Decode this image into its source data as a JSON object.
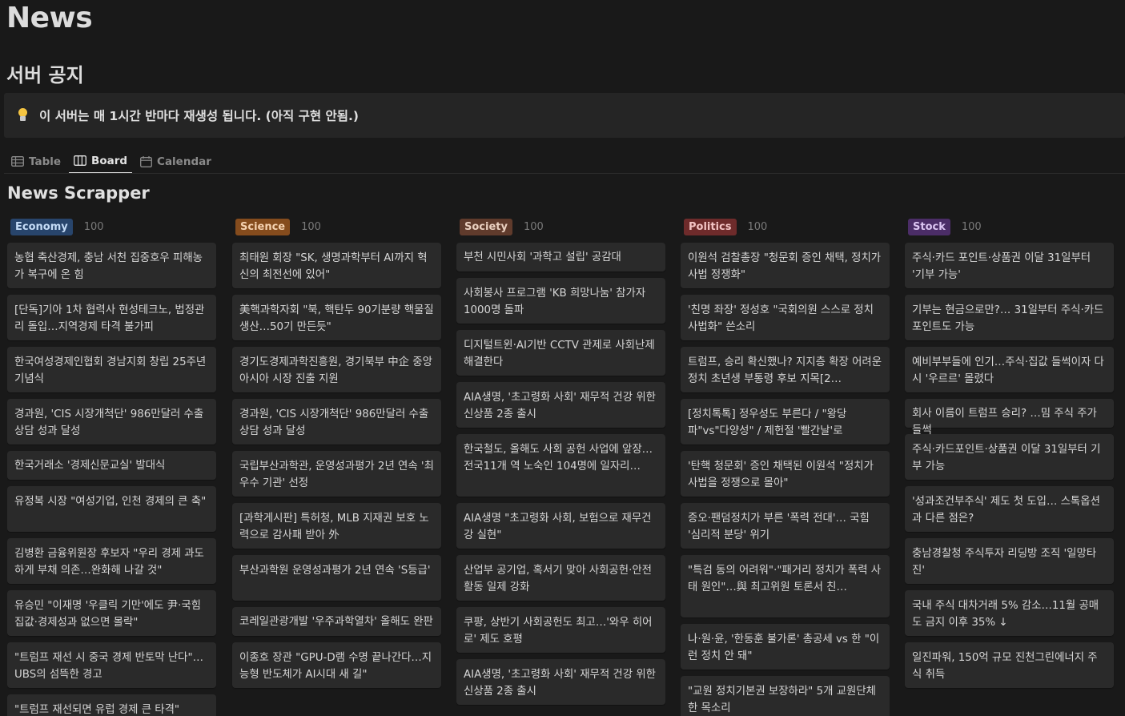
{
  "page": {
    "title": "News",
    "section_heading": "서버 공지",
    "callout_text": "이 서버는 매 1시간 반마다 재생성 됩니다. (아직 구현 안됨.)",
    "callout_icon": "lightbulb-icon"
  },
  "views": {
    "table": "Table",
    "board": "Board",
    "calendar": "Calendar",
    "active": "Board"
  },
  "database": {
    "title": "News Scrapper"
  },
  "columns": [
    {
      "name": "Economy",
      "count": "100",
      "badge_bg": "#28456c",
      "badge_fg": "#c5dcf7",
      "cards": [
        "농협 축산경제, 충남 서천 집중호우 피해농가 복구에 온 힘",
        "[단독]기아 1차 협력사 현성테크노, 법정관리 돌입…지역경제 타격 불가피",
        "한국여성경제인협회 경남지회 창립 25주년 기념식",
        "경과원, 'CIS 시장개척단' 986만달러 수출상담 성과 달성",
        "한국거래소 '경제신문교실' 발대식",
        "유정복 시장 \"여성기업, 인천 경제의 큰 축\"",
        "김병환 금융위원장 후보자 \"우리 경제 과도하게 부채 의존…완화해 나갈 것\"",
        "유승민 \"이재명 '우클릭 기만'에도 尹·국힘 집값·경제성과 없으면 몰락\"",
        "\"트럼프 재선 시 중국 경제 반토막 난다\"…UBS의 섬뜩한 경고",
        "\"트럼프 재선되면 유럽 경제 큰 타격\""
      ]
    },
    {
      "name": "Science",
      "count": "100",
      "badge_bg": "#854c1d",
      "badge_fg": "#f5d2b0",
      "cards": [
        "최태원 회장 \"SK, 생명과학부터 AI까지 혁신의 최전선에 있어\"",
        "美핵과학자회 \"북, 핵탄두 90기분량 핵물질생산…50기 만든듯\"",
        "경기도경제과학진흥원, 경기북부 中企 중앙아시아 시장 진출 지원",
        "경과원, 'CIS 시장개척단' 986만달러 수출상담 성과 달성",
        "국립부산과학관, 운영성과평가 2년 연속 '최우수 기관' 선정",
        "[과학게시판] 특허청, MLB 지재권 보호 노력으로 감사패 받아 外",
        "부산과학원 운영성과평가 2년 연속 'S등급'",
        "코레일관광개발 '우주과학열차' 올해도 완판",
        "이종호 장관 \"GPU-D램 수명 끝나간다…지능형 반도체가 AI시대 새 길\""
      ]
    },
    {
      "name": "Society",
      "count": "100",
      "badge_bg": "#603b2c",
      "badge_fg": "#ead0c0",
      "cards": [
        "부천 시민사회 '과학고 설립' 공감대",
        "사회봉사 프로그램 'KB 희망나눔' 참가자 1000명 돌파",
        "디지털트윈·AI기반 CCTV 관제로 사회난제 해결한다",
        "AIA생명, '초고령화 사회' 재무적 건강 위한 신상품 2종 출시",
        "한국철도, 올해도 사회 공헌 사업에 앞장…전국11개 역 노숙인 104명에 일자리…",
        "AIA생명 \"초고령화 사회, 보험으로 재무건강 실현\"",
        "산업부 공기업, 혹서기 맞아 사회공헌·안전활동 일제 강화",
        "쿠팡, 상반기 사회공헌도 최고…'와우 히어로' 제도 호평",
        "AIA생명, '초고령화 사회' 재무적 건강 위한 신상품 2종 출시"
      ]
    },
    {
      "name": "Politics",
      "count": "100",
      "badge_bg": "#6e2b2b",
      "badge_fg": "#f3c4c4",
      "cards": [
        "이원석 검찰총장 \"청문회 증인 채택, 정치가 사법 정쟁화\"",
        "'친명 좌장' 정성호 \"국회의원 스스로 정치 사법화\" 쓴소리",
        "트럼프, 승리 확신했나? 지지층 확장 어려운 정치 초년생 부통령 후보 지목[2…",
        "[정치톡톡] 정우성도 부른다 / \"왕당파\"vs\"다양성\" / 제헌절 '빨간날'로",
        "'탄핵 청문회' 증인 채택된 이원석 \"정치가 사법을 정쟁으로 몰아\"",
        "증오·팬덤정치가 부른 '폭력 전대'… 국힘 '심리적 분당' 위기",
        "\"특검 동의 어려워\"·\"패거리 정치가 폭력 사태 원인\"…與 최고위원 토론서 친…",
        "나·원·윤, '한동훈 불가론' 총공세 vs 한 \"이런 정치 안 돼\"",
        "\"교원 정치기본권 보장하라\" 5개 교원단체 한 목소리"
      ]
    },
    {
      "name": "Stock",
      "count": "100",
      "badge_bg": "#4b2d67",
      "badge_fg": "#dcc6f2",
      "cards": [
        "주식·카드 포인트·상품권 이달 31일부터 '기부 가능'",
        "기부는 현금으로만?… 31일부터 주식·카드포인트도 가능",
        "예비부부들에 인기…주식·집값 들썩이자 다시 '우르르' 몰렸다",
        "회사 이름이 트럼프 승리? …밈 주식 주가 들썩",
        "주식·카드포인트·상품권 이달 31일부터 기부 가능",
        "'성과조건부주식' 제도 첫 도입… 스톡옵션과 다른 점은?",
        "충남경찰청 주식투자 리딩방 조직 '일망타진'",
        "국내 주식 대차거래 5% 감소…11월 공매도 금지 이후 35% ↓",
        "일진파워, 150억 규모 진천그린에너지 주식 취득"
      ]
    }
  ]
}
